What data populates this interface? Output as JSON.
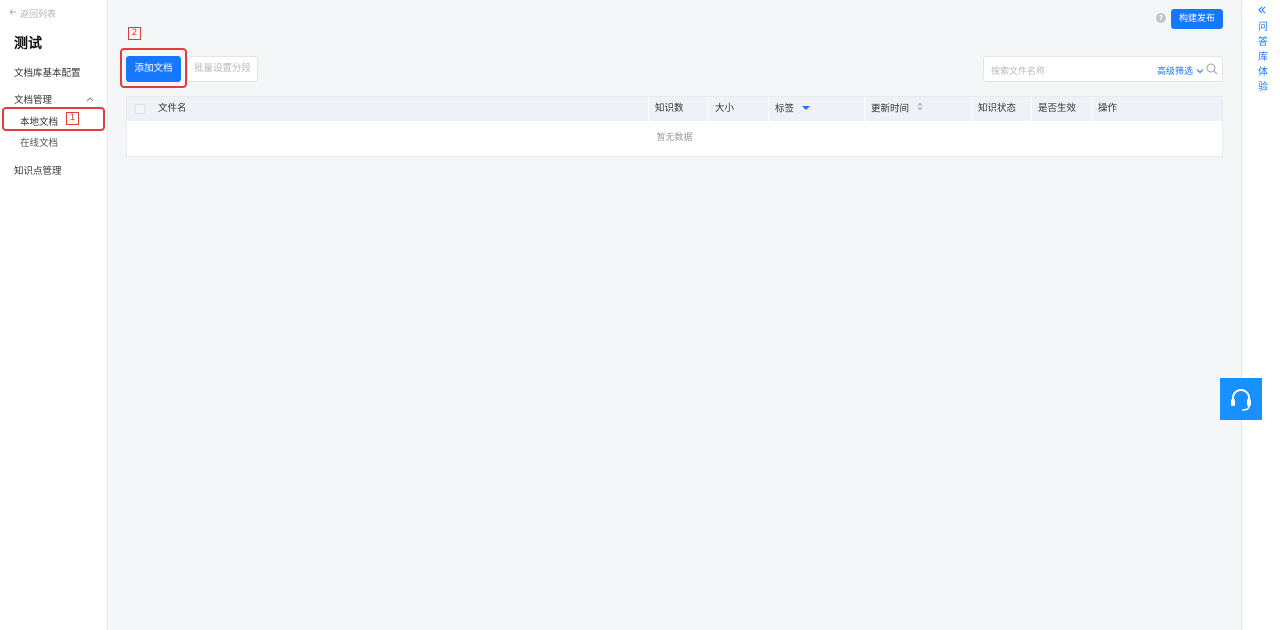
{
  "sidebar": {
    "back_label": "返回列表",
    "title": "测试",
    "items": {
      "config": "文档库基本配置",
      "docs": "文档管理",
      "local": "本地文档",
      "online": "在线文档",
      "knowledge": "知识点管理"
    },
    "marker_1": "1"
  },
  "toolbar": {
    "publish_label": "构建发布",
    "add_label": "添加文档",
    "batch_label": "批量设置分段",
    "marker_2": "2"
  },
  "search": {
    "placeholder": "搜索文件名称",
    "advanced_label": "高级筛选"
  },
  "table": {
    "columns": [
      "文件名",
      "知识数",
      "大小",
      "标签",
      "更新时间",
      "知识状态",
      "是否生效",
      "操作"
    ],
    "empty_text": "暂无数据"
  },
  "right_panel": {
    "chars": [
      "问",
      "答",
      "库",
      "体",
      "验"
    ]
  },
  "colors": {
    "accent": "#1677ff",
    "highlight": "#e23b3b"
  }
}
